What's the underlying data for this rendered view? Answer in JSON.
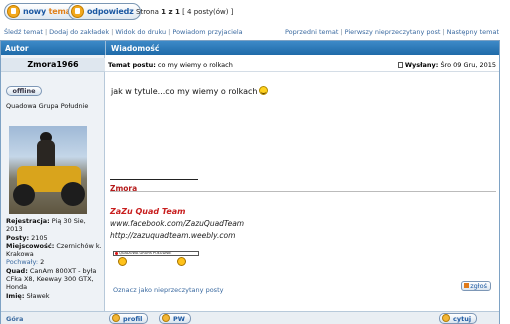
{
  "toolbar": {
    "new_topic_part1": "nowy",
    "new_topic_part2": "temat",
    "reply_label": "odpowiedz",
    "page_info_prefix": "Strona",
    "page_info_pages": "1 z 1",
    "page_info_posts": "[ 4 posty(ów) ]"
  },
  "nav": {
    "left": [
      "Śledź temat",
      "Dodaj do zakładek",
      "Widok do druku",
      "Powiadom przyjaciela"
    ],
    "right": [
      "Poprzedni temat",
      "Pierwszy nieprzeczytany post",
      "Następny temat"
    ]
  },
  "table": {
    "author_header": "Autor",
    "message_header": "Wiadomość"
  },
  "author": {
    "name": "Zmora1966",
    "status": "offline",
    "group": "Quadowa Grupa Południe",
    "info": [
      {
        "label": "Rejestracja:",
        "value": "Pią 30 Sie, 2013"
      },
      {
        "label": "Posty:",
        "value": "2105"
      },
      {
        "label": "Miejscowość:",
        "value": "Czernichów k. Krakowa"
      },
      {
        "label": "Pochwały:",
        "value": "2"
      },
      {
        "label": "Quad:",
        "value": "CanAm 800XT - była CFka X8, Keeway 300 GTX, Honda"
      },
      {
        "label": "Imię:",
        "value": "Sławek"
      }
    ]
  },
  "post": {
    "subject_label": "Temat postu:",
    "subject": "co my wiemy o rolkach",
    "sent_label": "Wysłany:",
    "sent": "Śro 09 Gru, 2015",
    "body": "jak w tytule...co my wiemy o rolkach",
    "signature_name": "Zmora",
    "team": "ZaZu Quad Team",
    "facebook": "www.facebook.com/ZazuQuadTeam",
    "website": "http://zazuquadteam.weebly.com",
    "banner_text": "QUADOWA GRUPA POŁUDNIE",
    "mark_unread": "Oznacz jako nieprzeczytany posty",
    "report_label": "zgłoś"
  },
  "footer": {
    "top_link": "Góra",
    "profile_label": "profil",
    "pm_label": "PW",
    "quote_label": "cytuj"
  },
  "colors": {
    "header_blue": "#1f6aa8",
    "link_blue": "#3b6aa0",
    "signature_red": "#c81e1e"
  }
}
